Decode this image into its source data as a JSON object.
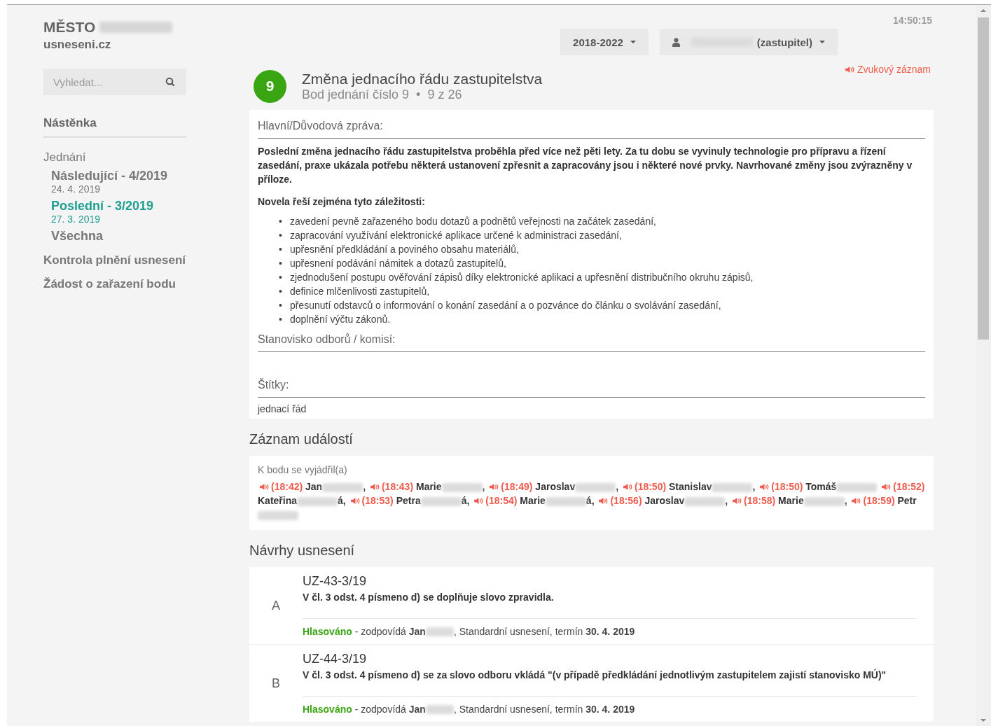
{
  "header": {
    "brand": "MĚSTO",
    "site": "usneseni.cz",
    "time": "14:50:15",
    "term_button": "2018-2022",
    "user_role": "(zastupitel)"
  },
  "search": {
    "placeholder": "Vyhledat..."
  },
  "sidebar": {
    "dashboard": "Nástěnka",
    "meetings": {
      "label": "Jednání",
      "items": [
        {
          "label": "Následující - 4/2019",
          "date": "24. 4. 2019",
          "selected": false
        },
        {
          "label": "Poslední - 3/2019",
          "date": "27. 3. 2019",
          "selected": true
        },
        {
          "label": "Všechna",
          "selected": false
        }
      ]
    },
    "links": [
      "Kontrola plnění usnesení",
      "Žádost o zařazení bodu"
    ]
  },
  "item": {
    "number": "9",
    "title": "Změna jednacího řádu zastupitelstva",
    "subtitle": "Bod jednání číslo 9",
    "separator": "•",
    "position": "9 z 26",
    "audio_link": "Zvukový záznam"
  },
  "report": {
    "heading": "Hlavní/Důvodová zpráva:",
    "paragraph": "Poslední změna jednacího řádu zastupitelstva proběhla před více než pěti lety. Za tu dobu se vyvinuly technologie pro přípravu a řízení zasedání, praxe ukázala potřebu některá ustanovení zpřesnit a zapracovány jsou i některé nové prvky. Navrhované změny jsou zvýrazněny v příloze.",
    "list_intro": "Novela řeší zejména tyto záležitosti:",
    "bullet_marker": "•",
    "bullets": [
      "zavedení pevně zařazeného bodu dotazů a podnětů veřejnosti na začátek zasedání,",
      "zapracování využívání elektronické aplikace určené k administraci zasedání,",
      "upřesnění předkládání a poviného obsahu materiálů,",
      "upřesnení podávání námitek a dotazů zastupitelů,",
      "zjednodušení postupu ověřování zápisů díky elektronické aplikaci a upřesnění distribučního okruhu zápisů,",
      "definice mlčenlivosti zastupitelů,",
      "přesunutí odstavců o informování o konání zasedání a o pozvánce do článku o svolávání zasedání,",
      "doplnění výčtu zákonů."
    ],
    "opinion_heading": "Stanovisko odborů / komisí:",
    "tags_heading": "Štítky:",
    "tags": "jednací řád"
  },
  "events": {
    "heading": "Záznam událostí",
    "label": "K bodu se vyjádřil(a)",
    "entries": [
      {
        "time": "(18:42)",
        "name": "Jan",
        "suffix": ","
      },
      {
        "time": "(18:43)",
        "name": "Marie",
        "suffix": ","
      },
      {
        "time": "(18:49)",
        "name": "Jaroslav",
        "suffix": ","
      },
      {
        "time": "(18:50)",
        "name": "Stanislav",
        "suffix": ","
      },
      {
        "time": "(18:50)",
        "name": "Tomáš"
      },
      {
        "time": "(18:52)",
        "name": "Kateřina",
        "suffix": "á,"
      },
      {
        "time": "(18:53)",
        "name": "Petra",
        "suffix": "á,"
      },
      {
        "time": "(18:54)",
        "name": "Marie",
        "suffix": "á,"
      },
      {
        "time": "(18:56)",
        "name": "Jaroslav",
        "suffix": ","
      },
      {
        "time": "(18:58)",
        "name": "Marie",
        "suffix": ","
      },
      {
        "time": "(18:59)",
        "name": "Petr"
      }
    ]
  },
  "proposals": {
    "heading": "Návrhy usnesení",
    "items": [
      {
        "letter": "A",
        "code": "UZ-43-3/19",
        "text": "V čl. 3 odst. 4 písmeno d) se doplňuje slovo zpravidla.",
        "status": "Hlasováno",
        "responsible": " - zodpovídá **Jan**",
        "details": ", Standardní usnesení, termín **30. 4. 2019**"
      },
      {
        "letter": "B",
        "code": "UZ-44-3/19",
        "text": "V čl. 3 odst. 4 písmeno d) se za slovo odboru vkládá \"(v případě předkládání jednotlivým zastupitelem zajistí stanovisko MÚ)\"",
        "status": "Hlasováno",
        "responsible": " - zodpovídá **Jan**",
        "details": ", Standardní usnesení, termín **30. 4. 2019**"
      }
    ]
  }
}
